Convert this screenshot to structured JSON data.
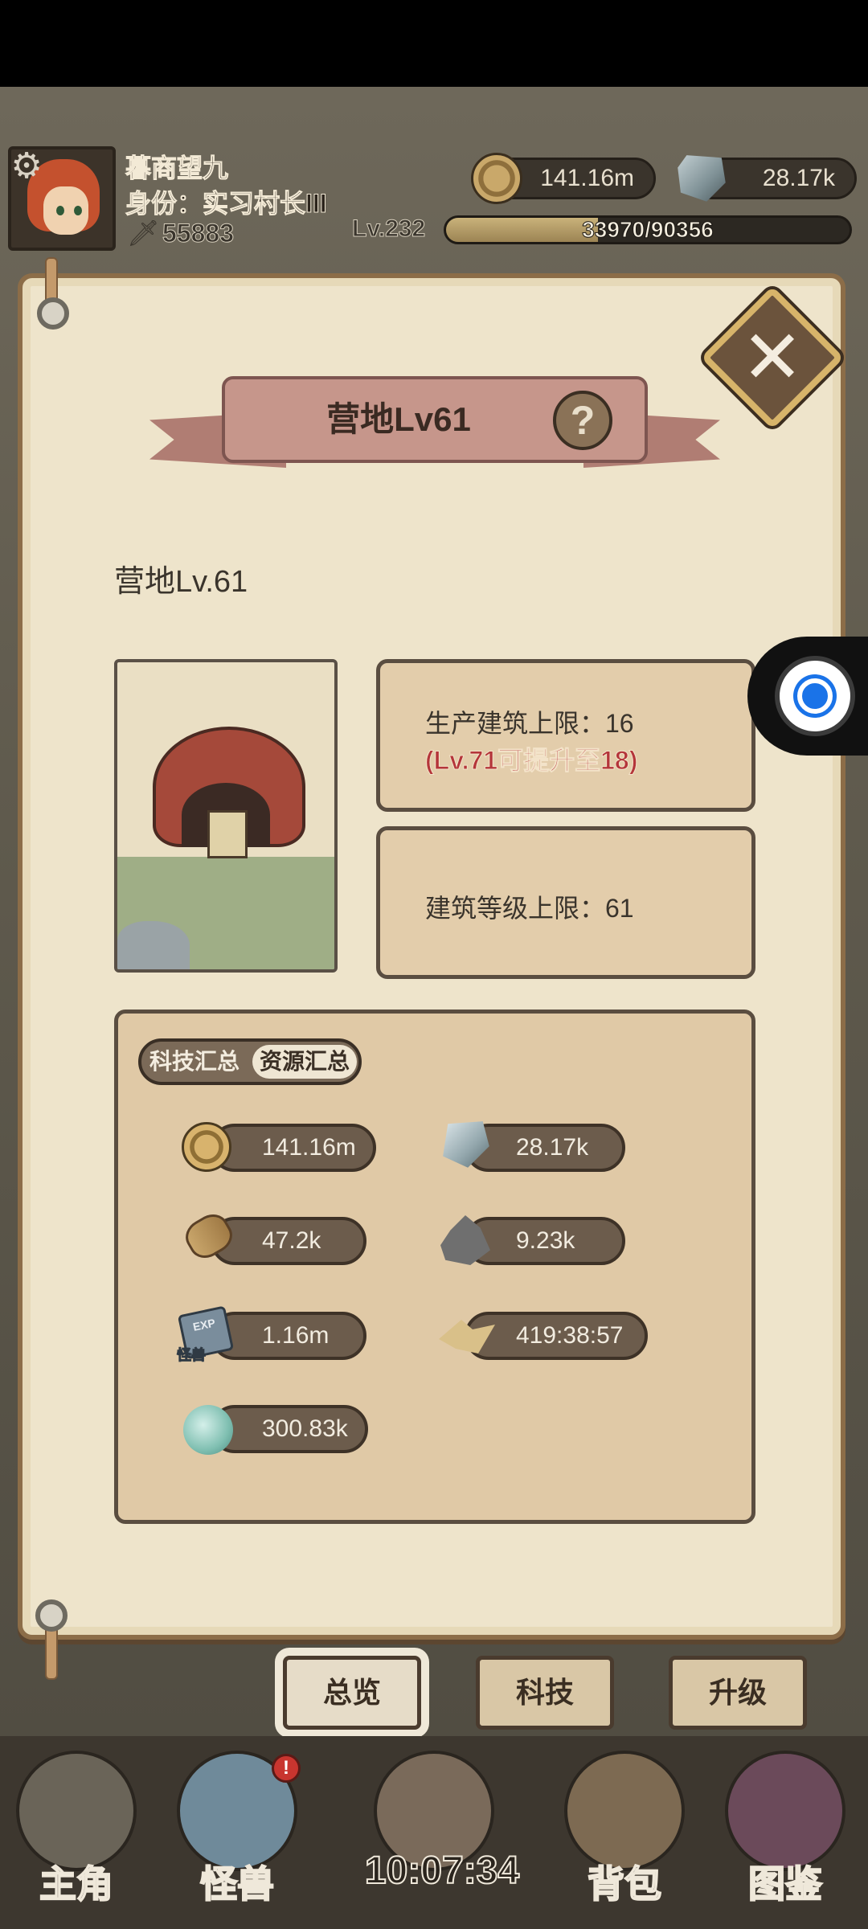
{
  "header": {
    "player_name": "暮商望九",
    "player_title": "身份：实习村长III",
    "power": "55883",
    "coins": "141.16m",
    "crystals": "28.17k",
    "level": "Lv.232",
    "exp_text": "33970/90356",
    "exp_fraction": 0.376
  },
  "dialog": {
    "title": "营地Lv61",
    "help_symbol": "?",
    "close_symbol": "✕",
    "subtitle": "营地Lv.61",
    "production_limit": "生产建筑上限：16",
    "production_upgrade": "(Lv.71可提升至18)",
    "building_level_limit": "建筑等级上限：61"
  },
  "resource_tabs": {
    "tech_summary": "科技汇总",
    "resource_summary": "资源汇总"
  },
  "resources": [
    {
      "icon": "coin-icon",
      "value": "141.16m"
    },
    {
      "icon": "crystal-icon",
      "value": "28.17k"
    },
    {
      "icon": "wood-icon",
      "value": "47.2k"
    },
    {
      "icon": "ore-icon",
      "value": "9.23k"
    },
    {
      "icon": "monster-exp-icon",
      "value": "1.16m"
    },
    {
      "icon": "map-icon",
      "value": "419:38:57"
    },
    {
      "icon": "water-icon",
      "value": "300.83k"
    }
  ],
  "exp_icon": {
    "top": "EXP",
    "bottom": "怪兽"
  },
  "bottom_tabs": [
    "总览",
    "科技",
    "升级"
  ],
  "nav": {
    "items": [
      "主角",
      "怪兽",
      "背包",
      "图鉴"
    ],
    "time": "10:07:34",
    "notification": "!"
  }
}
